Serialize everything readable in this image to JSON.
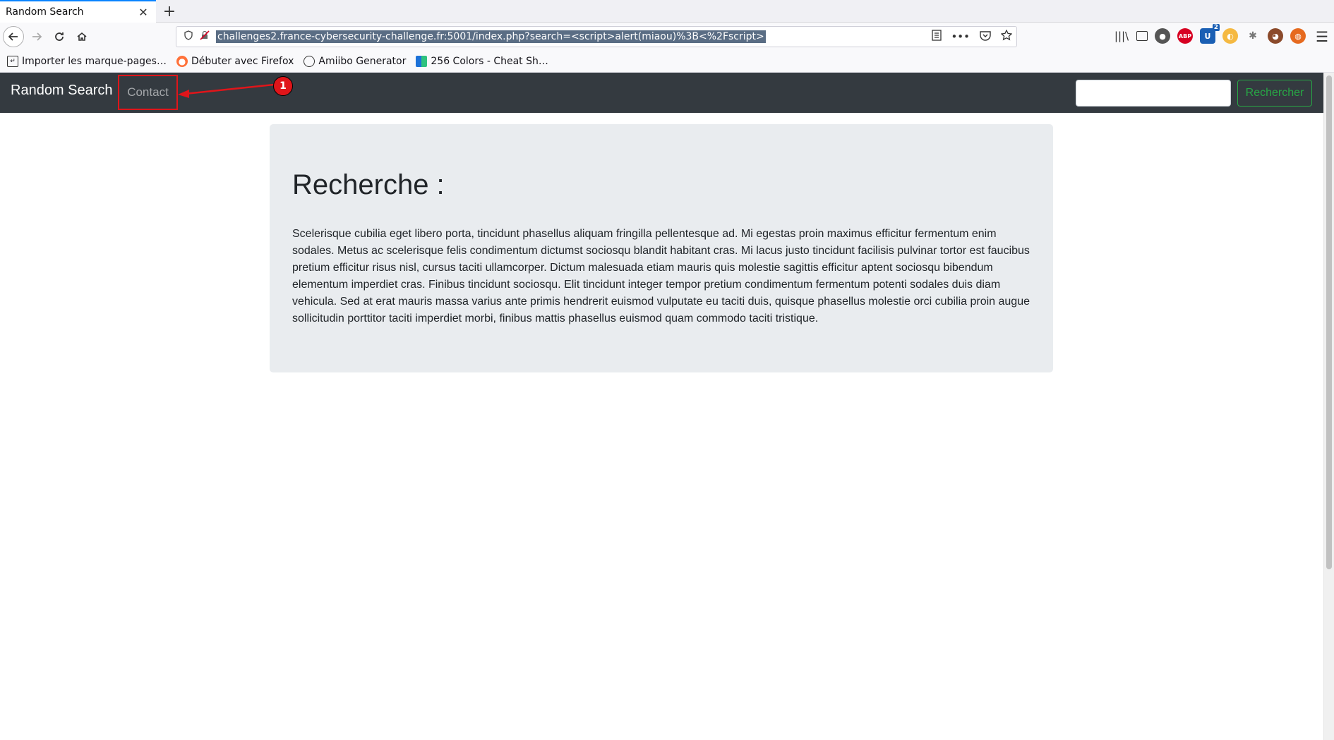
{
  "browser": {
    "tab_title": "Random Search",
    "tab_close": "✕",
    "new_tab": "+",
    "url": "challenges2.france-cybersecurity-challenge.fr:5001/index.php?search=<script>alert(miaou)%3B<%2Fscript>",
    "bookmarks": [
      {
        "label": "Importer les marque-pages…",
        "icon": "import-icon"
      },
      {
        "label": "Débuter avec Firefox",
        "icon": "firefox-icon"
      },
      {
        "label": "Amiibo Generator",
        "icon": "globe-icon"
      },
      {
        "label": "256 Colors - Cheat Sh…",
        "icon": "colors-icon"
      }
    ],
    "toolbar_badge": "2"
  },
  "site": {
    "brand": "Random Search",
    "nav_link": "Contact",
    "search_placeholder": "",
    "search_button": "Rechercher"
  },
  "annotation": {
    "badge": "1",
    "color": "#e0151a"
  },
  "content": {
    "title": "Recherche :",
    "paragraph": "Scelerisque cubilia eget libero porta, tincidunt phasellus aliquam fringilla pellentesque ad. Mi egestas proin maximus efficitur fermentum enim sodales. Metus ac scelerisque felis condimentum dictumst sociosqu blandit habitant cras. Mi lacus justo tincidunt facilisis pulvinar tortor est faucibus pretium efficitur risus nisl, cursus taciti ullamcorper. Dictum malesuada etiam mauris quis molestie sagittis efficitur aptent sociosqu bibendum elementum imperdiet cras. Finibus tincidunt sociosqu. Elit tincidunt integer tempor pretium condimentum fermentum potenti sodales duis diam vehicula. Sed at erat mauris massa varius ante primis hendrerit euismod vulputate eu taciti duis, quisque phasellus molestie orci cubilia proin augue sollicitudin porttitor taciti imperdiet morbi, finibus mattis phasellus euismod quam commodo taciti tristique."
  },
  "colors": {
    "navbar": "#343a40",
    "jumbotron": "#e9ecef",
    "success": "#28a745"
  }
}
